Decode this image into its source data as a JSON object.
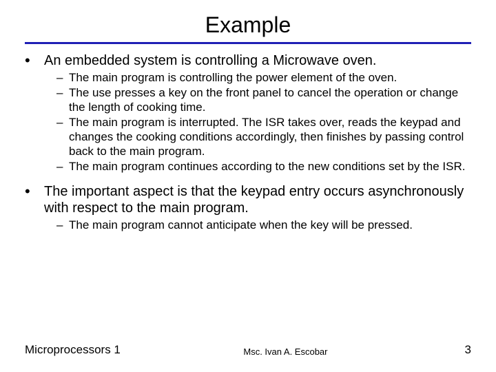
{
  "title": "Example",
  "bullets": [
    {
      "text": "An embedded system is controlling a Microwave oven.",
      "sub": [
        "The main program is controlling the power element of the oven.",
        "The use presses a key on the front panel to cancel the operation or change the length of cooking time.",
        "The main program is interrupted. The ISR takes over, reads the keypad and changes the cooking conditions accordingly, then finishes by passing control back to the main program.",
        "The main program continues according to the new conditions set by the ISR."
      ]
    },
    {
      "text": "The important aspect is that the keypad entry occurs asynchronously with respect to the main program.",
      "sub": [
        "The main program cannot anticipate when the key will be pressed."
      ]
    }
  ],
  "footer": {
    "left": "Microprocessors 1",
    "center": "Msc. Ivan A. Escobar",
    "page": "3"
  }
}
